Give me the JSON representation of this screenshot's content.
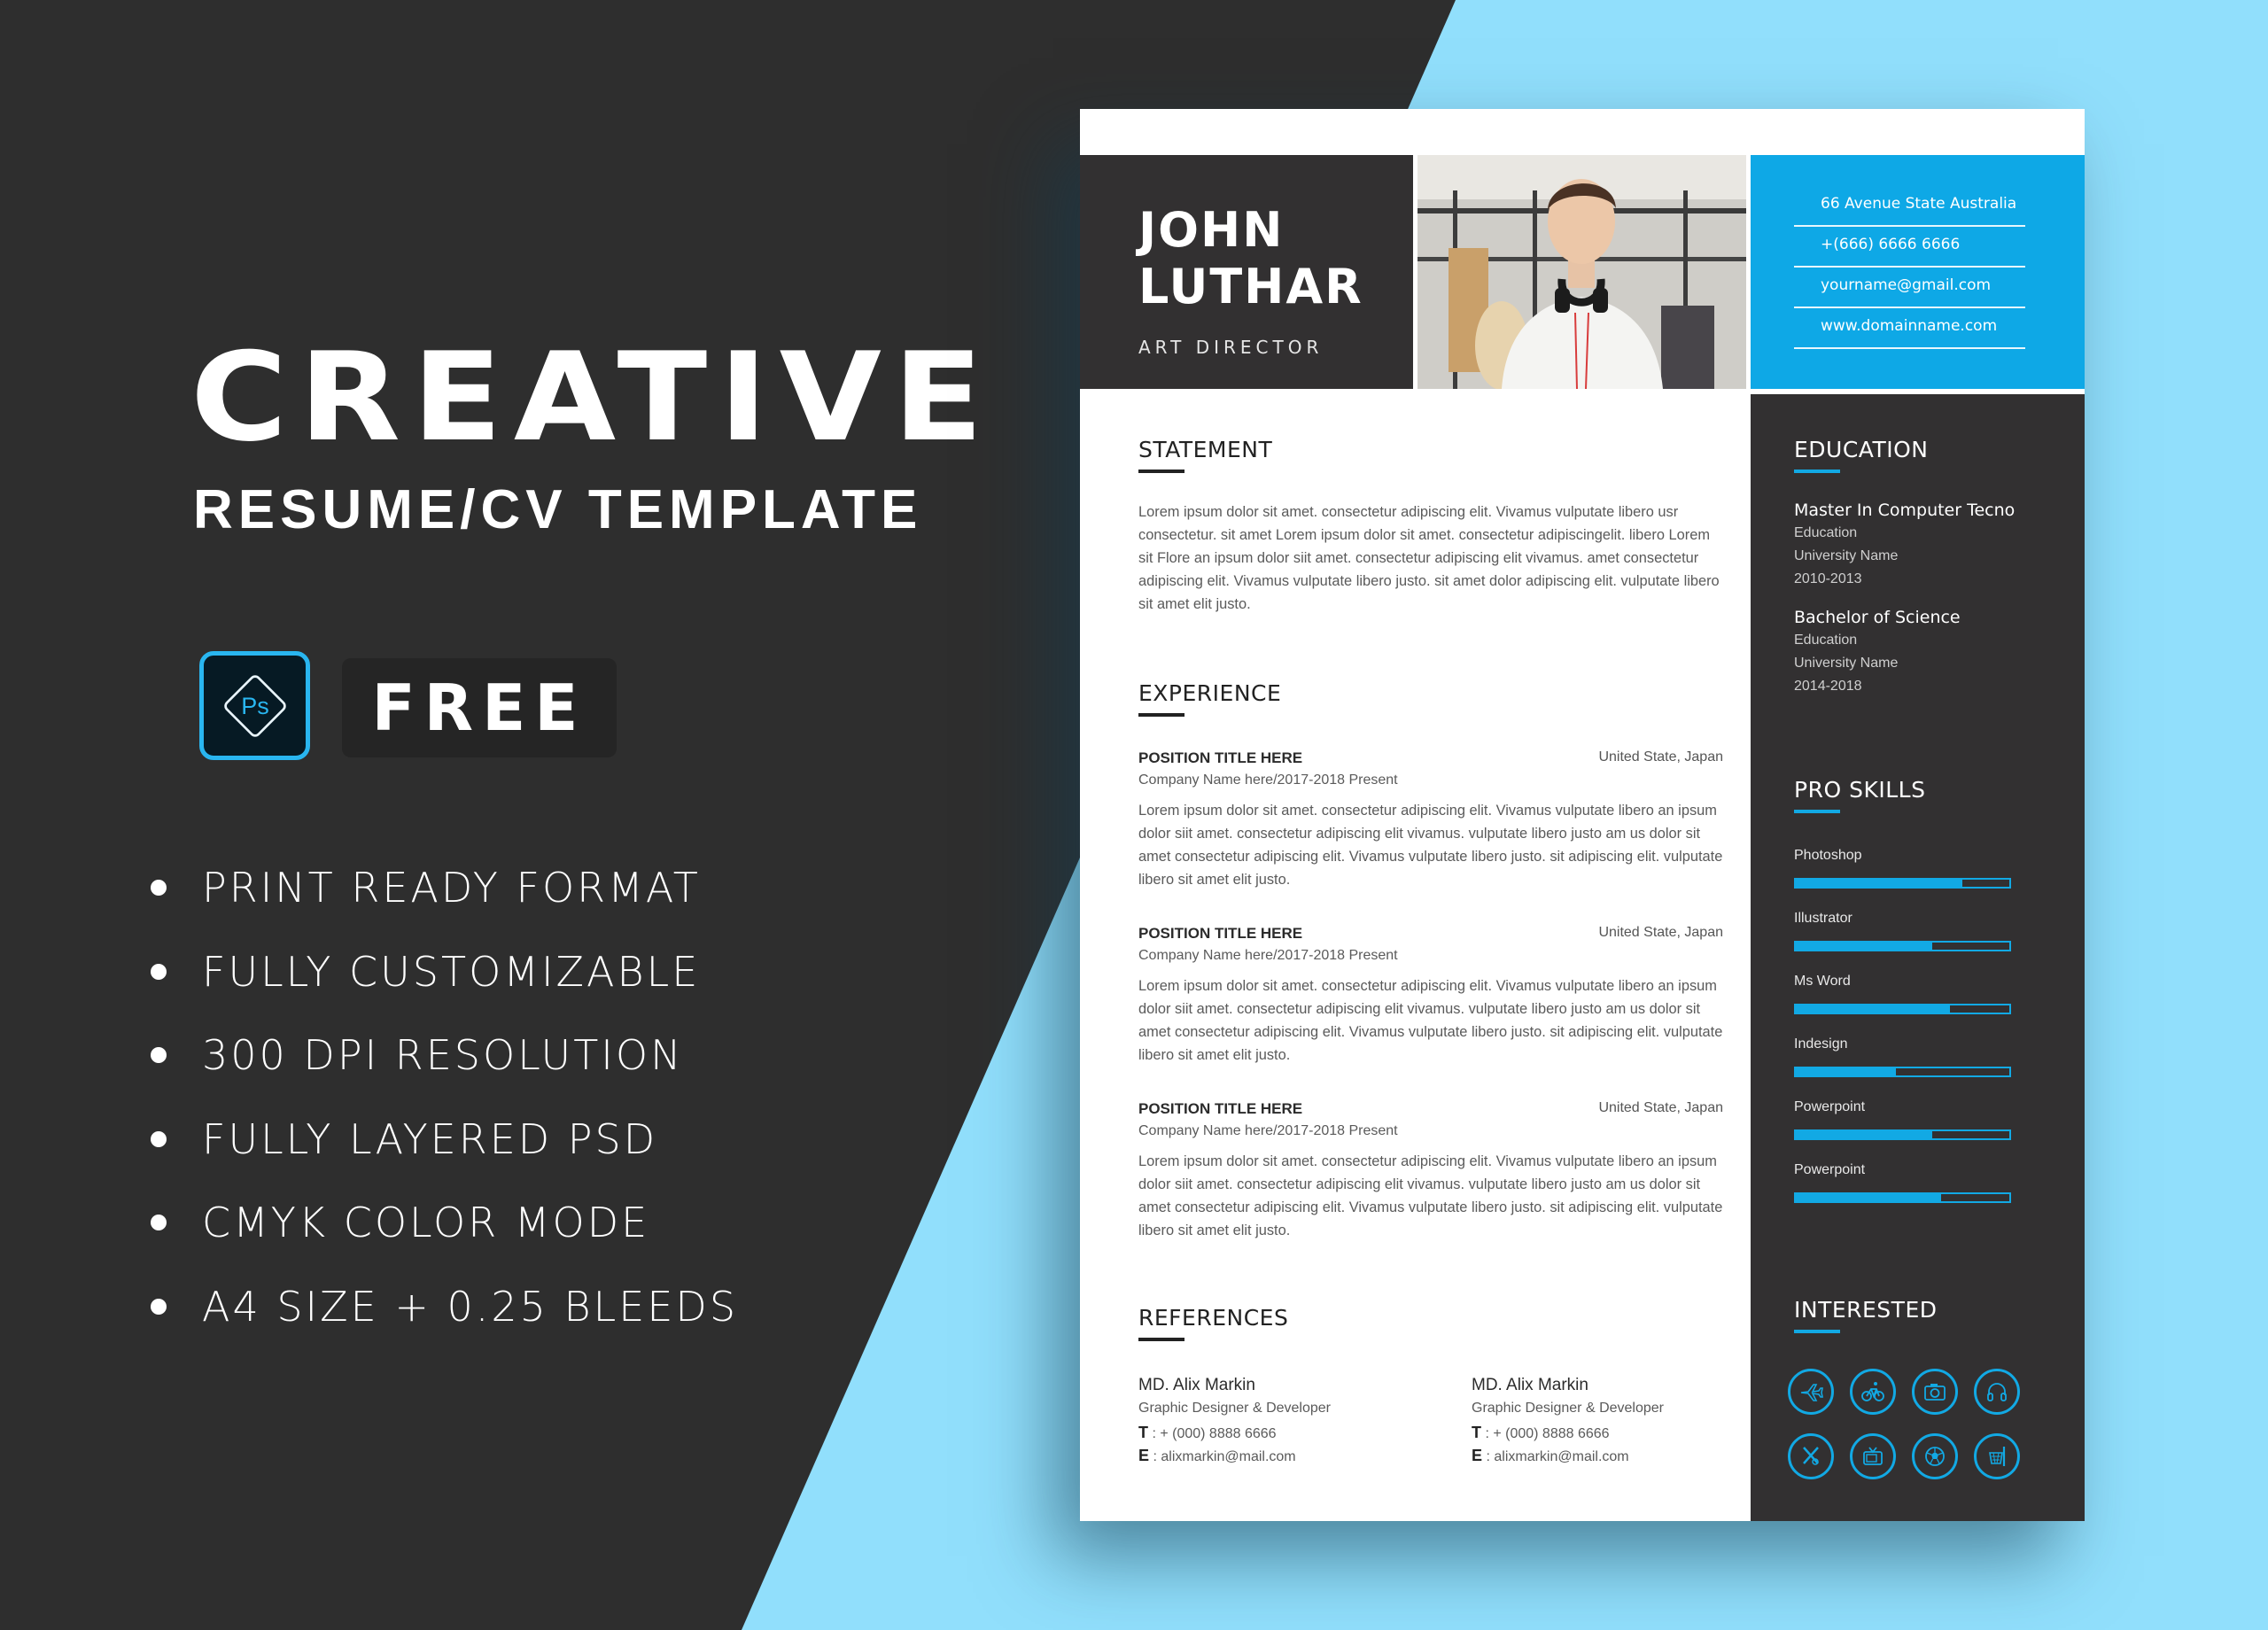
{
  "promo": {
    "title": "CREATIVE",
    "subtitle": "RESUME/CV TEMPLATE",
    "ps_icon_label": "Ps",
    "badge": "FREE",
    "features": [
      "PRINT READY  FORMAT",
      "FULLY CUSTOMIZABLE",
      "300 DPI RESOLUTION",
      "FULLY LAYERED PSD",
      "CMYK COLOR MODE",
      "A4 SIZE + 0.25 BLEEDS"
    ]
  },
  "resume": {
    "first_name": "JOHN",
    "last_name": "LUTHAR",
    "role": "ART DIRECTOR",
    "contact": [
      "66 Avenue State Australia",
      "+(666) 6666 6666",
      "yourname@gmail.com",
      "www.domainname.com"
    ],
    "statement": {
      "title": "STATEMENT",
      "text": "Lorem ipsum dolor sit amet. consectetur adipiscing elit. Vivamus vulputate libero usr consectetur. sit amet Lorem ipsum dolor sit amet. consectetur adipiscingelit. libero Lorem sit Flore an ipsum dolor siit amet. consectetur adipiscing elit vivamus. amet consectetur adipiscing elit. Vivamus vulputate libero justo. sit amet dolor adipiscing elit. vulputate libero sit amet elit justo."
    },
    "experience": {
      "title": "EXPERIENCE",
      "items": [
        {
          "position": "POSITION TITLE HERE",
          "location": "United State, Japan",
          "company": "Company Name here/2017-2018 Present",
          "text": "Lorem ipsum dolor sit amet. consectetur adipiscing elit. Vivamus vulputate libero an ipsum dolor siit amet. consectetur adipiscing elit vivamus. vulputate libero justo am us dolor sit amet consectetur adipiscing elit. Vivamus vulputate libero justo. sit adipiscing elit. vulputate libero sit amet elit justo."
        },
        {
          "position": "POSITION TITLE HERE",
          "location": "United State, Japan",
          "company": "Company Name here/2017-2018 Present",
          "text": "Lorem ipsum dolor sit amet. consectetur adipiscing elit. Vivamus vulputate libero an ipsum dolor siit amet. consectetur adipiscing elit vivamus. vulputate libero justo am us dolor sit amet consectetur adipiscing elit. Vivamus vulputate libero justo. sit adipiscing elit. vulputate libero sit amet elit justo."
        },
        {
          "position": "POSITION TITLE HERE",
          "location": "United State, Japan",
          "company": "Company Name here/2017-2018 Present",
          "text": "Lorem ipsum dolor sit amet. consectetur adipiscing elit. Vivamus vulputate libero an ipsum dolor siit amet. consectetur adipiscing elit vivamus. vulputate libero justo am us dolor sit amet consectetur adipiscing elit. Vivamus vulputate libero justo. sit adipiscing elit. vulputate libero sit amet elit justo."
        }
      ]
    },
    "references": {
      "title": "REFERENCES",
      "items": [
        {
          "name": "MD. Alix Markin",
          "role": "Graphic Designer & Developer",
          "t_label": "T",
          "phone": "+ (000) 8888 6666",
          "e_label": "E",
          "email": "alixmarkin@mail.com"
        },
        {
          "name": "MD. Alix Markin",
          "role": "Graphic Designer & Developer",
          "t_label": "T",
          "phone": "+ (000) 8888 6666",
          "e_label": "E",
          "email": "alixmarkin@mail.com"
        }
      ]
    },
    "education": {
      "title": "EDUCATION",
      "items": [
        {
          "degree": "Master In Computer Tecno",
          "field": "Education",
          "school": "University Name",
          "years": "2010-2013"
        },
        {
          "degree": "Bachelor of Science",
          "field": "Education",
          "school": "University Name",
          "years": "2014-2018"
        }
      ]
    },
    "skills": {
      "title": "PRO SKILLS",
      "items": [
        {
          "name": "Photoshop",
          "level": 0.78
        },
        {
          "name": "Illustrator",
          "level": 0.64
        },
        {
          "name": "Ms Word",
          "level": 0.72
        },
        {
          "name": "Indesign",
          "level": 0.47
        },
        {
          "name": "Powerpoint",
          "level": 0.64
        },
        {
          "name": "Powerpoint",
          "level": 0.68
        }
      ]
    },
    "interests": {
      "title": "INTERESTED",
      "icons": [
        "plane-icon",
        "bicycle-icon",
        "camera-icon",
        "headphones-icon",
        "cricket-icon",
        "tv-icon",
        "soccer-ball-icon",
        "basketball-hoop-icon"
      ]
    }
  },
  "colors": {
    "accent": "#12a9e4",
    "dark_panel": "#323031",
    "background_dark": "#2e2e2e",
    "background_light": "#91dffc"
  }
}
